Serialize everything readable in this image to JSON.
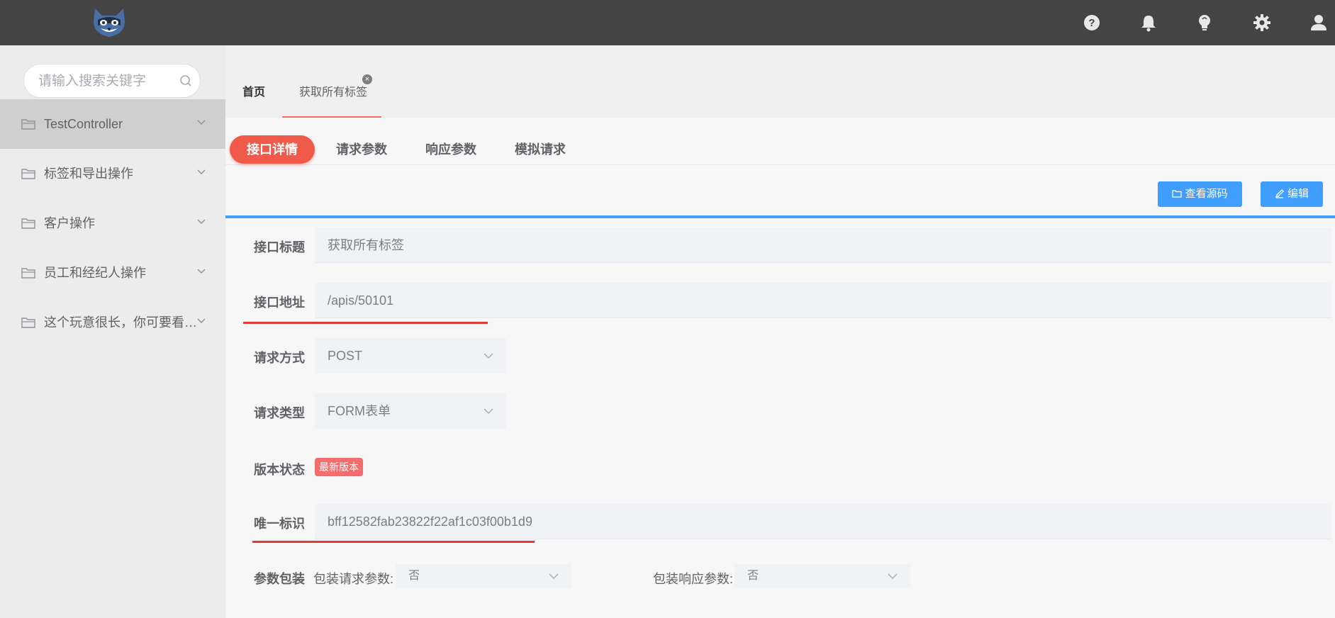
{
  "topbar": {
    "logo": "raccoon-logo",
    "icons": [
      "help-icon",
      "bell-icon",
      "lightbulb-icon",
      "gear-icon",
      "user-icon"
    ]
  },
  "sidebar": {
    "search_placeholder": "请输入搜索关键字",
    "items": [
      {
        "label": "TestController"
      },
      {
        "label": "标签和导出操作"
      },
      {
        "label": "客户操作"
      },
      {
        "label": "员工和经纪人操作"
      },
      {
        "label": "这个玩意很长，你可要看着…"
      }
    ]
  },
  "page_tabs": {
    "home": "首页",
    "current": "获取所有标签",
    "close_symbol": "×"
  },
  "subtabs": [
    "接口详情",
    "请求参数",
    "响应参数",
    "模拟请求"
  ],
  "buttons": {
    "view_source": "查看源码",
    "edit": "编辑"
  },
  "form": {
    "title_label": "接口标题",
    "title_value": "获取所有标签",
    "url_label": "接口地址",
    "url_value": "/apis/50101",
    "method_label": "请求方式",
    "method_value": "POST",
    "type_label": "请求类型",
    "type_value": "FORM表单",
    "version_label": "版本状态",
    "version_badge": "最新版本",
    "uid_label": "唯一标识",
    "uid_value": "bff12582fab23822f22af1c03f00b1d9",
    "wrap_label": "参数包装",
    "wrap_request_label": "包装请求参数:",
    "wrap_request_value": "否",
    "wrap_response_label": "包装响应参数:",
    "wrap_response_value": "否"
  },
  "colors": {
    "topbar": "#444444",
    "accent_red": "#f05a4a",
    "primary_blue": "#409eff",
    "annotation_red": "#e53935"
  }
}
